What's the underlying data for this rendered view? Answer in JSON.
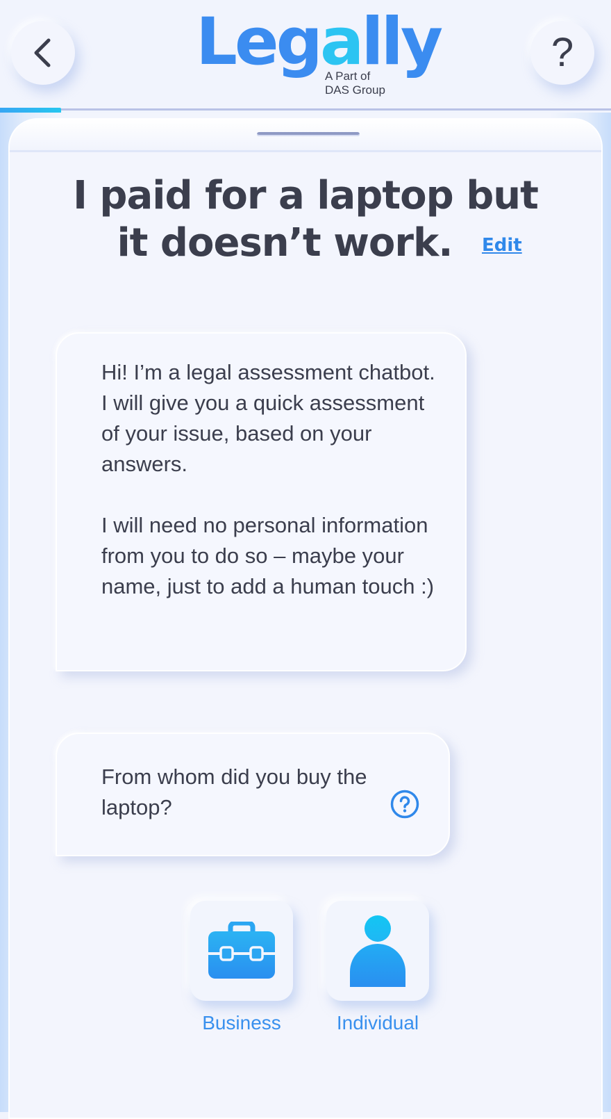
{
  "header": {
    "back_icon": "chevron-left-icon",
    "help_icon": "question-mark-icon",
    "help_label": "?",
    "logo": {
      "word": "Legally",
      "sub_line1": "A Part of",
      "sub_line2": "DAS Group"
    },
    "progress": 0.1,
    "colors": {
      "brand_blue": "#3b8cf0",
      "brand_cyan": "#2cc4f2",
      "progress": "#37a6f3"
    }
  },
  "main": {
    "title_line1": "I paid for a laptop but",
    "title_line2": "it doesn’t work.",
    "edit_label": "Edit"
  },
  "chat": {
    "intro_p1": "Hi! I’m a legal assessment chatbot. I will give you a quick assessment of your issue, based on your answers.",
    "intro_p2": "I will need no personal information from you to do so – maybe your name, just to add a human touch :)",
    "question": "From whom did you buy the laptop?",
    "question_help_icon": "question-circle-icon"
  },
  "options": [
    {
      "label": "Business",
      "icon": "briefcase-icon"
    },
    {
      "label": "Individual",
      "icon": "person-icon"
    }
  ]
}
